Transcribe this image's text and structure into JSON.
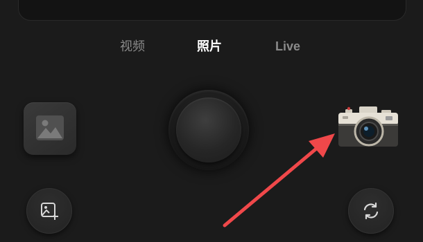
{
  "modes": {
    "tabs": [
      {
        "label": "视频"
      },
      {
        "label": "照片"
      },
      {
        "label": "Live"
      }
    ],
    "active_index": 1
  },
  "controls": {
    "gallery_icon": "image-icon",
    "shutter_icon": "shutter-button",
    "camera_icon": "camera-icon",
    "edit_icon": "add-image-icon",
    "flip_icon": "switch-camera-icon"
  },
  "annotation": {
    "arrow_color": "#f0484a"
  },
  "colors": {
    "background": "#1b1b1b",
    "active_tab": "#ffffff",
    "inactive_tab": "#8a8a8a"
  }
}
